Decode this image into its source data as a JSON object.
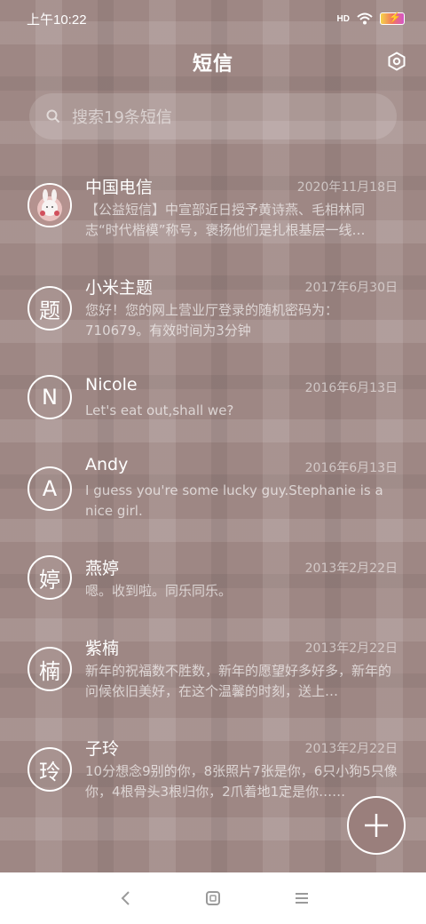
{
  "status": {
    "time": "上午10:22",
    "signal": "HD"
  },
  "header": {
    "title": "短信"
  },
  "search": {
    "placeholder": "搜索19条短信"
  },
  "threads": [
    {
      "avatar": "",
      "name": "中国电信",
      "date": "2020年11月18日",
      "snippet": "【公益短信】中宣部近日授予黄诗燕、毛相林同志“时代楷模”称号，褒扬他们是扎根基层一线…"
    },
    {
      "avatar": "题",
      "name": "小米主题",
      "date": "2017年6月30日",
      "snippet": "您好！您的网上营业厅登录的随机密码为：710679。有效时间为3分钟"
    },
    {
      "avatar": "N",
      "name": "Nicole",
      "date": "2016年6月13日",
      "snippet": "Let's eat out,shall we?"
    },
    {
      "avatar": "A",
      "name": "Andy",
      "date": "2016年6月13日",
      "snippet": "I guess you're some lucky guy.Stephanie is a nice girl."
    },
    {
      "avatar": "婷",
      "name": "燕婷",
      "date": "2013年2月22日",
      "snippet": "嗯。收到啦。同乐同乐。"
    },
    {
      "avatar": "楠",
      "name": "紫楠",
      "date": "2013年2月22日",
      "snippet": "新年的祝福数不胜数，新年的愿望好多好多，新年的问候依旧美好，在这个温馨的时刻，送上…"
    },
    {
      "avatar": "玲",
      "name": "子玲",
      "date": "2013年2月22日",
      "snippet": "10分想念9别的你，8张照片7张是你，6只小狗5只像你，4根骨头3根归你，2爪着地1定是你……"
    }
  ]
}
